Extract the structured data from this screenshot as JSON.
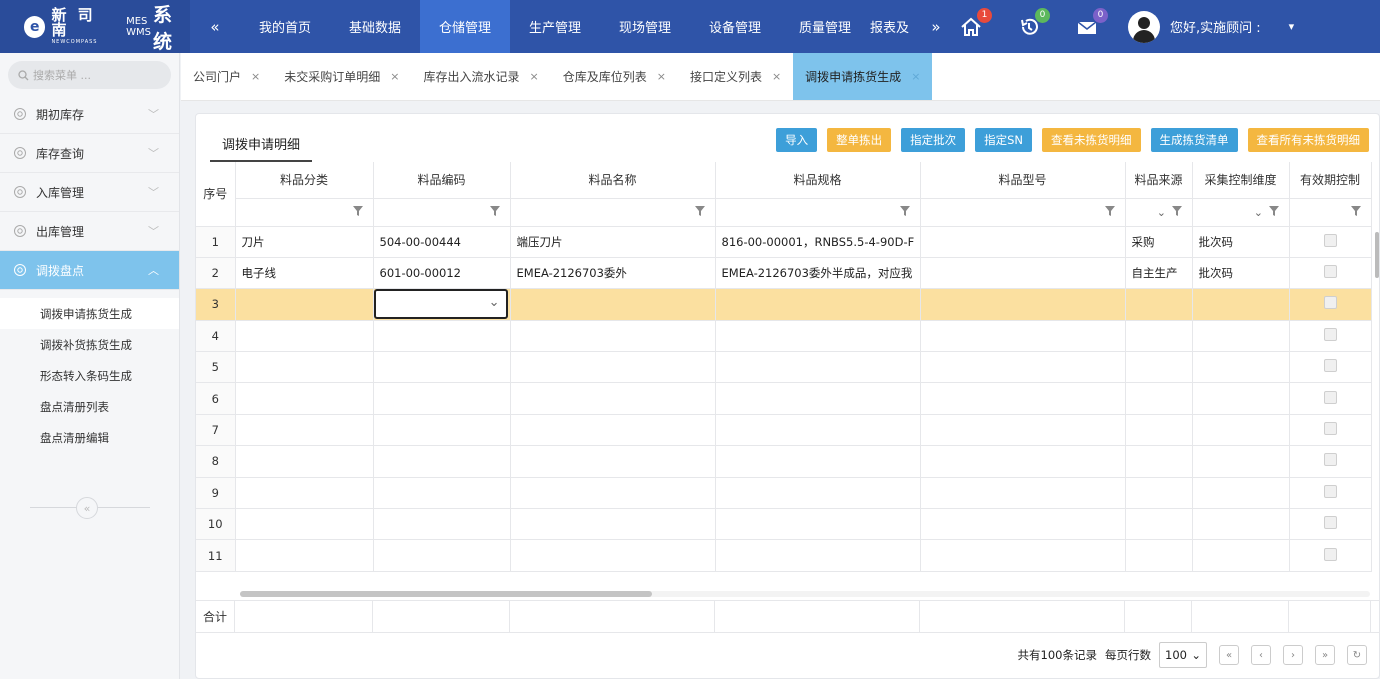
{
  "app": {
    "brand_cn": "新 司 南",
    "brand_en": "NEWCOMPASS",
    "mes": "MES",
    "wms": "WMS",
    "system": "系统",
    "collapse_glyph": "«",
    "more_glyph": "»"
  },
  "nav": [
    "我的首页",
    "基础数据",
    "仓储管理",
    "生产管理",
    "现场管理",
    "设备管理",
    "质量管理",
    "报表及"
  ],
  "nav_active": "仓储管理",
  "header_icons": [
    {
      "icon": "home-icon",
      "badge": "1",
      "color": "#e84a3c"
    },
    {
      "icon": "history-icon",
      "badge": "0",
      "color": "#5cb85c"
    },
    {
      "icon": "mail-icon",
      "badge": "0",
      "color": "#7b61c9"
    }
  ],
  "user": {
    "greeting": "您好,实施顾问 :",
    "caret": "▾"
  },
  "sidebar": {
    "search_placeholder": "搜索菜单 ...",
    "groups": [
      "期初库存",
      "库存查询",
      "入库管理",
      "出库管理",
      "调拨盘点"
    ],
    "active_group": "调拨盘点",
    "subitems": [
      "调拨申请拣货生成",
      "调拨补货拣货生成",
      "形态转入条码生成",
      "盘点清册列表",
      "盘点清册编辑"
    ],
    "active_subitem": "调拨申请拣货生成",
    "collapse_glyph": "«"
  },
  "tabs": [
    "公司门户",
    "未交采购订单明细",
    "库存出入流水记录",
    "仓库及库位列表",
    "接口定义列表",
    "调拨申请拣货生成"
  ],
  "active_tab": "调拨申请拣货生成",
  "tab_close": "×",
  "panel": {
    "title": "调拨申请明细",
    "buttons": [
      {
        "label": "导入",
        "color": "#3d9fd9"
      },
      {
        "label": "整单拣出",
        "color": "#f4b740"
      },
      {
        "label": "指定批次",
        "color": "#3d9fd9"
      },
      {
        "label": "指定SN",
        "color": "#3d9fd9"
      },
      {
        "label": "查看未拣货明细",
        "color": "#f4b740"
      },
      {
        "label": "生成拣货清单",
        "color": "#3d9fd9"
      },
      {
        "label": "查看所有未拣货明细",
        "color": "#f4b740"
      }
    ]
  },
  "table": {
    "columns": [
      "序号",
      "料品分类",
      "料品编码",
      "料品名称",
      "料品规格",
      "料品型号",
      "料品来源",
      "采集控制维度",
      "有效期控制"
    ],
    "rows": [
      {
        "no": "1",
        "cat": "刀片",
        "code": "504-00-00444",
        "name": "端压刀片",
        "spec": "816-00-00001，RNBS5.5-4-90D-F",
        "model": "",
        "source": "采购",
        "dim": "批次码"
      },
      {
        "no": "2",
        "cat": "电子线",
        "code": "601-00-00012",
        "name": "EMEA-2126703委外",
        "spec": "EMEA-2126703委外半成品，对应我",
        "model": "",
        "source": "自主生产",
        "dim": "批次码"
      },
      {
        "no": "3",
        "cat": "",
        "code": "",
        "name": "",
        "spec": "",
        "model": "",
        "source": "",
        "dim": ""
      },
      {
        "no": "4",
        "cat": "",
        "code": "",
        "name": "",
        "spec": "",
        "model": "",
        "source": "",
        "dim": ""
      },
      {
        "no": "5",
        "cat": "",
        "code": "",
        "name": "",
        "spec": "",
        "model": "",
        "source": "",
        "dim": ""
      },
      {
        "no": "6",
        "cat": "",
        "code": "",
        "name": "",
        "spec": "",
        "model": "",
        "source": "",
        "dim": ""
      },
      {
        "no": "7",
        "cat": "",
        "code": "",
        "name": "",
        "spec": "",
        "model": "",
        "source": "",
        "dim": ""
      },
      {
        "no": "8",
        "cat": "",
        "code": "",
        "name": "",
        "spec": "",
        "model": "",
        "source": "",
        "dim": ""
      },
      {
        "no": "9",
        "cat": "",
        "code": "",
        "name": "",
        "spec": "",
        "model": "",
        "source": "",
        "dim": ""
      },
      {
        "no": "10",
        "cat": "",
        "code": "",
        "name": "",
        "spec": "",
        "model": "",
        "source": "",
        "dim": ""
      },
      {
        "no": "11",
        "cat": "",
        "code": "",
        "name": "",
        "spec": "",
        "model": "",
        "source": "",
        "dim": ""
      }
    ],
    "selected_row": "3",
    "total_label": "合计"
  },
  "pager": {
    "summary": "共有100条记录",
    "per_page_label": "每页行数",
    "per_page": "100",
    "first": "«",
    "prev": "‹",
    "next": "›",
    "last": "»",
    "refresh": "↻"
  }
}
